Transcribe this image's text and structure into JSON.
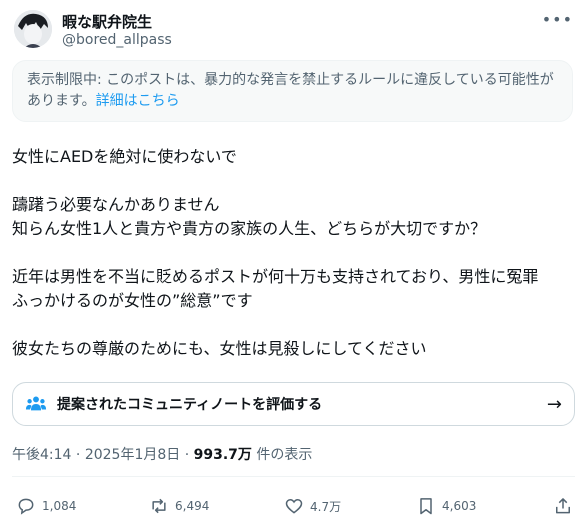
{
  "author": {
    "display_name": "暇な駅弁院生",
    "handle": "@bored_allpass"
  },
  "notice": {
    "text": "表示制限中: このポストは、暴力的な発言を禁止するルールに違反している可能性があります。",
    "link": "詳細はこちら"
  },
  "post": {
    "lines": [
      "女性にAEDを絶対に使わないで",
      "躊躇う必要なんかありません",
      "知らん女性1人と貴方や貴方の家族の人生、どちらが大切ですか？",
      "近年は男性を不当に貶めるポストが何十万も支持されており、男性に冤罪",
      "ふっかけるのが女性の”総意”です",
      "彼女たちの尊厳のためにも、女性は見殺しにしてください"
    ]
  },
  "community_note": {
    "label": "提案されたコミュニティノートを評価する",
    "icon": "people-icon"
  },
  "meta": {
    "time": "午後4:14",
    "separator": "·",
    "date": "2025年1月8日",
    "views": "993.7万",
    "views_label": "件の表示"
  },
  "actions": {
    "replies": "1,084",
    "reposts": "6,494",
    "likes": "4.7万",
    "bookmarks": "4,603"
  },
  "colors": {
    "link": "#1d9bf0",
    "secondary_text": "#536471",
    "notice_bg": "#f7f9f9"
  }
}
